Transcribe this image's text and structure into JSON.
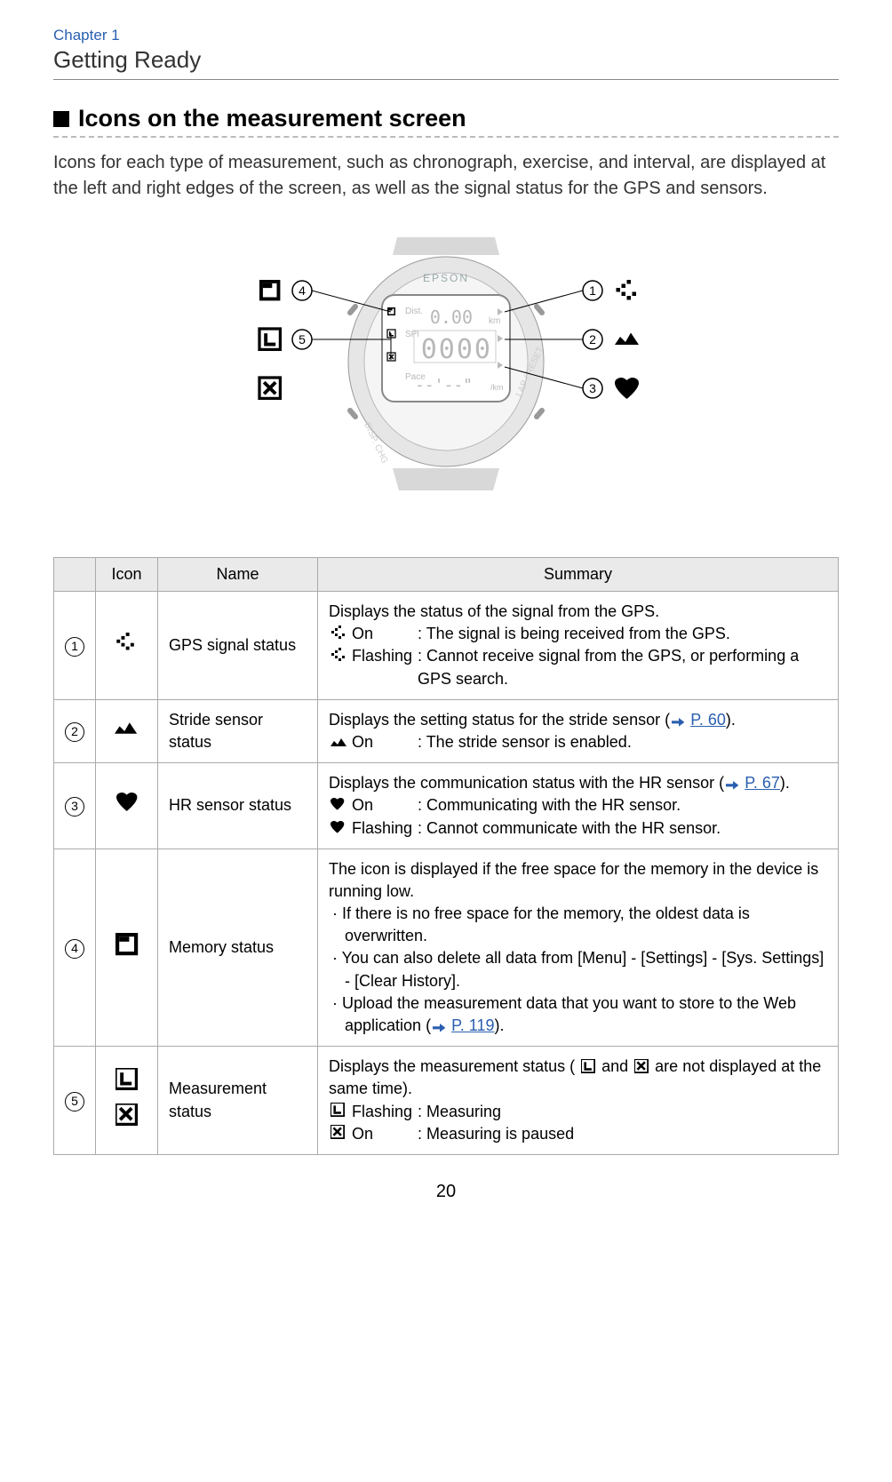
{
  "header": {
    "chapter": "Chapter 1",
    "section_title": "Getting Ready"
  },
  "section_heading": "Icons on the measurement screen",
  "intro_text": "Icons for each type of measurement, such as chronograph, exercise, and interval, are displayed at the left and right edges of the screen, as well as the signal status for the GPS and sensors.",
  "figure": {
    "brand": "EPSON",
    "labels": {
      "dist": "Dist.",
      "spl": "SPl",
      "pace": "Pace",
      "dist_unit": "km",
      "pace_unit": "/km",
      "time_zero": "0000",
      "dist_zero": "0.00",
      "dash_pace": "--'--\"",
      "lap": "LAP / RESET",
      "disp": "DISP. CHG"
    },
    "callouts": [
      "1",
      "2",
      "3",
      "4",
      "5"
    ]
  },
  "table": {
    "headers": {
      "icon": "Icon",
      "name": "Name",
      "summary": "Summary"
    },
    "rows": [
      {
        "num": "1",
        "icon": "gps",
        "name": "GPS signal status",
        "summary_intro": "Displays the status of the signal from the GPS.",
        "states": [
          {
            "icon": "gps",
            "label": "On",
            "desc": "The signal is being received from the GPS."
          },
          {
            "icon": "gps",
            "label": "Flashing",
            "desc": "Cannot receive signal from the GPS, or performing a GPS search."
          }
        ]
      },
      {
        "num": "2",
        "icon": "stride",
        "name": "Stride sensor status",
        "summary_intro_pre": "Displays the setting status for the stride sensor (",
        "link_text": "P. 60",
        "summary_intro_post": ").",
        "states": [
          {
            "icon": "stride",
            "label": "On",
            "desc": "The stride sensor is enabled."
          }
        ]
      },
      {
        "num": "3",
        "icon": "hr",
        "name": "HR sensor status",
        "summary_intro_pre": "Displays the communication status with the HR sensor (",
        "link_text": "P. 67",
        "summary_intro_post": ").",
        "states": [
          {
            "icon": "hr",
            "label": "On",
            "desc": "Communicating with the HR sensor."
          },
          {
            "icon": "hr",
            "label": "Flashing",
            "desc": "Cannot communicate with the HR sensor."
          }
        ]
      },
      {
        "num": "4",
        "icon": "mem",
        "name": "Memory status",
        "summary_intro": "The icon is displayed if the free space for the memory in the device is running low.",
        "bullets": [
          "If there is no free space for the memory, the oldest data is overwritten.",
          "You can also delete all data from [Menu] - [Settings] - [Sys. Settings] - [Clear History]."
        ],
        "bullet_link_pre": "Upload the measurement data that you want to store to the Web application (",
        "bullet_link_text": "P. 119",
        "bullet_link_post": ")."
      },
      {
        "num": "5",
        "icon": "meas",
        "name": "Measurement status",
        "summary_intro_pre": "Displays the measurement status ( ",
        "summary_intro_mid": " and ",
        "summary_intro_post": " are not displayed at the same time).",
        "states": [
          {
            "icon": "meas_l",
            "label": "Flashing",
            "desc": "Measuring"
          },
          {
            "icon": "meas_x",
            "label": "On",
            "desc": "Measuring is paused"
          }
        ]
      }
    ]
  },
  "page_number": "20"
}
